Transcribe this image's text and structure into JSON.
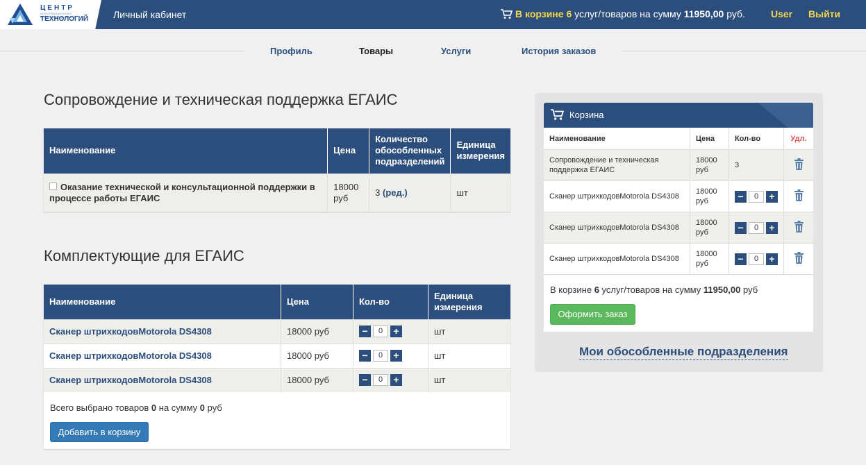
{
  "header": {
    "logo_line1": "ЦЕНТР",
    "logo_line1_sub": "ИНФОРМАЦИОННЫХ КОММУНИКАЦИОННЫХ",
    "logo_line2": "ТЕХНОЛОГИЙ",
    "cabinet_title": "Личный кабинет",
    "cart_prefix": "В корзине",
    "cart_count": "6",
    "cart_mid": "услуг/товаров на сумму",
    "cart_sum": "11950,00",
    "cart_currency": "руб.",
    "user_label": "User",
    "logout_label": "Выйти"
  },
  "nav": {
    "tabs": [
      {
        "label": "Профиль",
        "active": false
      },
      {
        "label": "Товары",
        "active": true
      },
      {
        "label": "Услуги",
        "active": false
      },
      {
        "label": "История заказов",
        "active": false
      }
    ]
  },
  "services": {
    "title": "Сопровождение и техническая поддержка ЕГАИС",
    "columns": [
      "Наименование",
      "Цена",
      "Количество обособленных подразделений",
      "Единица измерения"
    ],
    "rows": [
      {
        "name": "Оказание технической и консультационной поддержки в процессе работы ЕГАИС",
        "price": "18000 руб",
        "qty": "3",
        "edit": "(ред.)",
        "unit": "шт"
      }
    ]
  },
  "components": {
    "title": "Комплектующие для ЕГАИС",
    "columns": [
      "Наименование",
      "Цена",
      "Кол-во",
      "Единица измерения"
    ],
    "rows": [
      {
        "name": "Сканер штрихкодовMotorola DS4308",
        "price": "18000 руб",
        "qty": "0",
        "unit": "шт"
      },
      {
        "name": "Сканер штрихкодовMotorola DS4308",
        "price": "18000 руб",
        "qty": "0",
        "unit": "шт"
      },
      {
        "name": "Сканер штрихкодовMotorola DS4308",
        "price": "18000 руб",
        "qty": "0",
        "unit": "шт"
      }
    ],
    "total_prefix": "Всего выбрано товаров",
    "total_count": "0",
    "total_mid": "на сумму",
    "total_sum": "0",
    "total_currency": "руб",
    "add_button": "Добавить в корзину"
  },
  "cart": {
    "title": "Корзина",
    "columns": [
      "Наименование",
      "Цена",
      "Кол-во",
      "Удл."
    ],
    "rows": [
      {
        "name": "Сопровождение и техническая поддержка ЕГАИС",
        "price": "18000 руб",
        "qty": "3",
        "stepper": false
      },
      {
        "name": "Сканер штрихкодовMotorola DS4308",
        "price": "18000 руб",
        "qty": "0",
        "stepper": true
      },
      {
        "name": "Сканер штрихкодовMotorola DS4308",
        "price": "18000 руб",
        "qty": "0",
        "stepper": true
      },
      {
        "name": "Сканер штрихкодовMotorola DS4308",
        "price": "18000 руб",
        "qty": "0",
        "stepper": true
      }
    ],
    "total_prefix": "В корзине",
    "total_count": "6",
    "total_mid": "услуг/товаров на сумму",
    "total_sum": "11950,00",
    "total_currency": "руб",
    "order_button": "Оформить заказ",
    "divisions_link": "Мои обособленные подразделения"
  },
  "colors": {
    "primary": "#2b4e7c",
    "highlight": "#f2d64b",
    "success": "#5cb85c",
    "button_blue": "#337ab7",
    "danger": "#d9534f"
  },
  "icons": [
    "cart-icon",
    "trash-icon",
    "minus-icon",
    "plus-icon",
    "checkbox-icon",
    "logo-icon"
  ]
}
